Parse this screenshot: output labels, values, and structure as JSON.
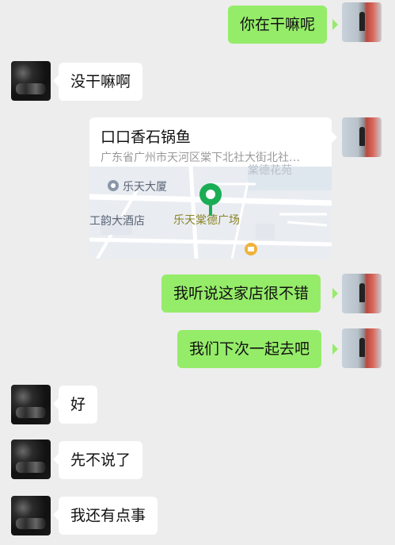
{
  "messages": [
    {
      "side": "me",
      "text": "你在干嘛呢"
    },
    {
      "side": "other",
      "text": "没干嘛啊"
    },
    {
      "side": "me",
      "type": "location",
      "title": "口口香石锅鱼",
      "address": "广东省广州市天河区棠下北社大街北社…"
    },
    {
      "side": "me",
      "text": "我听说这家店很不错"
    },
    {
      "side": "me",
      "text": "我们下次一起去吧"
    },
    {
      "side": "other",
      "text": "好"
    },
    {
      "side": "other",
      "text": "先不说了"
    },
    {
      "side": "other",
      "text": "我还有点事"
    }
  ],
  "map": {
    "poi_lotte_building": "乐天大厦",
    "poi_hotel": "工韵大酒店",
    "poi_plaza": "乐天棠德广场",
    "poi_faded_top": "棠德花苑"
  },
  "colors": {
    "background": "#ededed",
    "my_bubble": "#95ec69",
    "other_bubble": "#ffffff",
    "map_pin": "#1aad54"
  }
}
